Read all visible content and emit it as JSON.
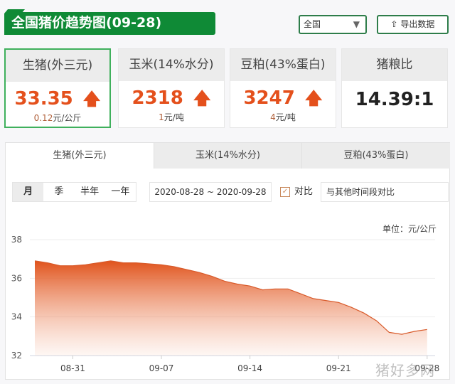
{
  "header": {
    "title": "全国猪价趋势图(09-28)",
    "region_select": "全国",
    "export_label": "导出数据"
  },
  "cards": [
    {
      "title": "生猪(外三元)",
      "value": "33.35",
      "change": "0.12",
      "unit": "元/公斤",
      "trend": "up"
    },
    {
      "title": "玉米(14%水分)",
      "value": "2318",
      "change": "1",
      "unit": "元/吨",
      "trend": "up"
    },
    {
      "title": "豆粕(43%蛋白)",
      "value": "3247",
      "change": "4",
      "unit": "元/吨",
      "trend": "up"
    },
    {
      "title": "猪粮比",
      "value": "14.39:1"
    }
  ],
  "tabs": [
    "生猪(外三元)",
    "玉米(14%水分)",
    "豆粕(43%蛋白)"
  ],
  "periods": [
    "月",
    "季",
    "半年",
    "一年"
  ],
  "date_range": "2020-08-28 ~ 2020-09-28",
  "compare": {
    "label": "对比",
    "checked": true,
    "placeholder": "与其他时间段对比"
  },
  "watermark": "猪好多网",
  "colors": {
    "accent": "#e4501c",
    "green": "#0f8a36"
  },
  "chart_data": {
    "type": "area",
    "unit_label": "单位：元/公斤",
    "ylim": [
      32,
      38
    ],
    "yticks": [
      "38",
      "36",
      "34",
      "32"
    ],
    "xticks": [
      "08-31",
      "09-07",
      "09-14",
      "09-21",
      "09-28"
    ],
    "x": [
      "08-28",
      "08-29",
      "08-30",
      "08-31",
      "09-01",
      "09-02",
      "09-03",
      "09-04",
      "09-05",
      "09-06",
      "09-07",
      "09-08",
      "09-09",
      "09-10",
      "09-11",
      "09-12",
      "09-13",
      "09-14",
      "09-15",
      "09-16",
      "09-17",
      "09-18",
      "09-19",
      "09-20",
      "09-21",
      "09-22",
      "09-23",
      "09-24",
      "09-25",
      "09-26",
      "09-27",
      "09-28"
    ],
    "values": [
      36.9,
      36.8,
      36.65,
      36.65,
      36.7,
      36.8,
      36.9,
      36.8,
      36.8,
      36.75,
      36.7,
      36.6,
      36.45,
      36.3,
      36.1,
      35.85,
      35.7,
      35.6,
      35.4,
      35.45,
      35.45,
      35.2,
      34.95,
      34.85,
      34.75,
      34.5,
      34.2,
      33.8,
      33.2,
      33.1,
      33.25,
      33.35
    ],
    "grid": true
  }
}
